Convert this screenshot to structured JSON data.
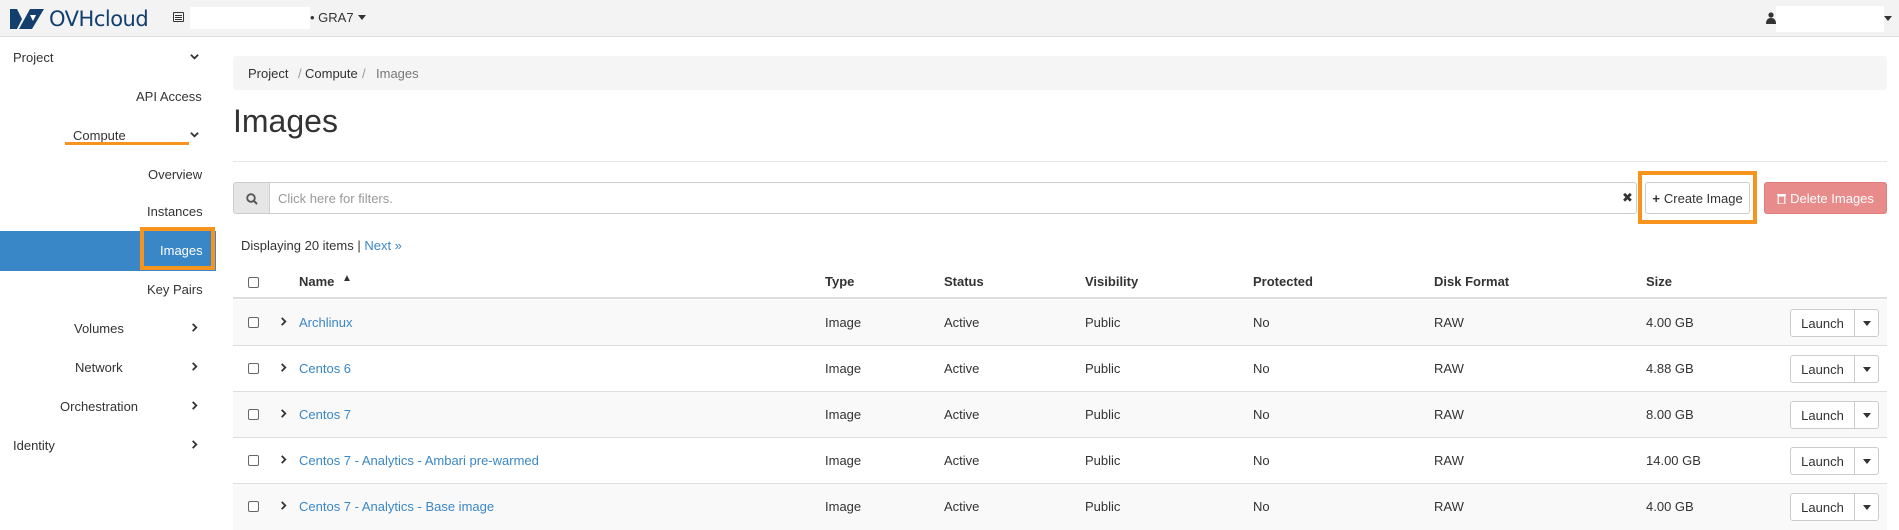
{
  "topbar": {
    "brand": "OVHcloud",
    "region": "• GRA7",
    "icons": {
      "brand_logo": "ovh-logo-icon",
      "project": "project-icon",
      "user": "user-icon",
      "caret": "caret-down-icon"
    }
  },
  "sidebar": {
    "items": [
      {
        "label": "Project",
        "icon": "chevron-down-icon"
      },
      {
        "label": "API Access"
      },
      {
        "label": "Compute",
        "icon": "chevron-down-icon"
      },
      {
        "label": "Overview"
      },
      {
        "label": "Instances"
      },
      {
        "label": "Images",
        "active": true
      },
      {
        "label": "Key Pairs"
      },
      {
        "label": "Volumes",
        "icon": "chevron-right-icon"
      },
      {
        "label": "Network",
        "icon": "chevron-right-icon"
      },
      {
        "label": "Orchestration",
        "icon": "chevron-right-icon"
      },
      {
        "label": "Identity",
        "icon": "chevron-right-icon"
      }
    ]
  },
  "breadcrumb": {
    "items": [
      "Project",
      "Compute",
      "Images"
    ],
    "separator": "/"
  },
  "page": {
    "title": "Images"
  },
  "filter": {
    "placeholder": "Click here for filters.",
    "search_icon": "search-icon",
    "clear_icon": "close-icon"
  },
  "actions": {
    "create_label": "Create Image",
    "delete_label": "Delete Images"
  },
  "display": {
    "text": "Displaying 20 items |",
    "next_label": "Next »"
  },
  "table": {
    "columns": [
      "Name",
      "Type",
      "Status",
      "Visibility",
      "Protected",
      "Disk Format",
      "Size"
    ],
    "sort_icon": "sort-asc-icon",
    "rows": [
      {
        "name": "Archlinux",
        "type": "Image",
        "status": "Active",
        "visibility": "Public",
        "protected": "No",
        "disk_format": "RAW",
        "size": "4.00 GB",
        "action": "Launch"
      },
      {
        "name": "Centos 6",
        "type": "Image",
        "status": "Active",
        "visibility": "Public",
        "protected": "No",
        "disk_format": "RAW",
        "size": "4.88 GB",
        "action": "Launch"
      },
      {
        "name": "Centos 7",
        "type": "Image",
        "status": "Active",
        "visibility": "Public",
        "protected": "No",
        "disk_format": "RAW",
        "size": "8.00 GB",
        "action": "Launch"
      },
      {
        "name": "Centos 7 - Analytics - Ambari pre-warmed",
        "type": "Image",
        "status": "Active",
        "visibility": "Public",
        "protected": "No",
        "disk_format": "RAW",
        "size": "14.00 GB",
        "action": "Launch"
      },
      {
        "name": "Centos 7 - Analytics - Base image",
        "type": "Image",
        "status": "Active",
        "visibility": "Public",
        "protected": "No",
        "disk_format": "RAW",
        "size": "4.00 GB",
        "action": "Launch"
      }
    ]
  },
  "colors": {
    "accent": "#3a87c7",
    "highlight": "#f7941d",
    "danger": "#e88b8b",
    "brand": "#123f6d"
  }
}
